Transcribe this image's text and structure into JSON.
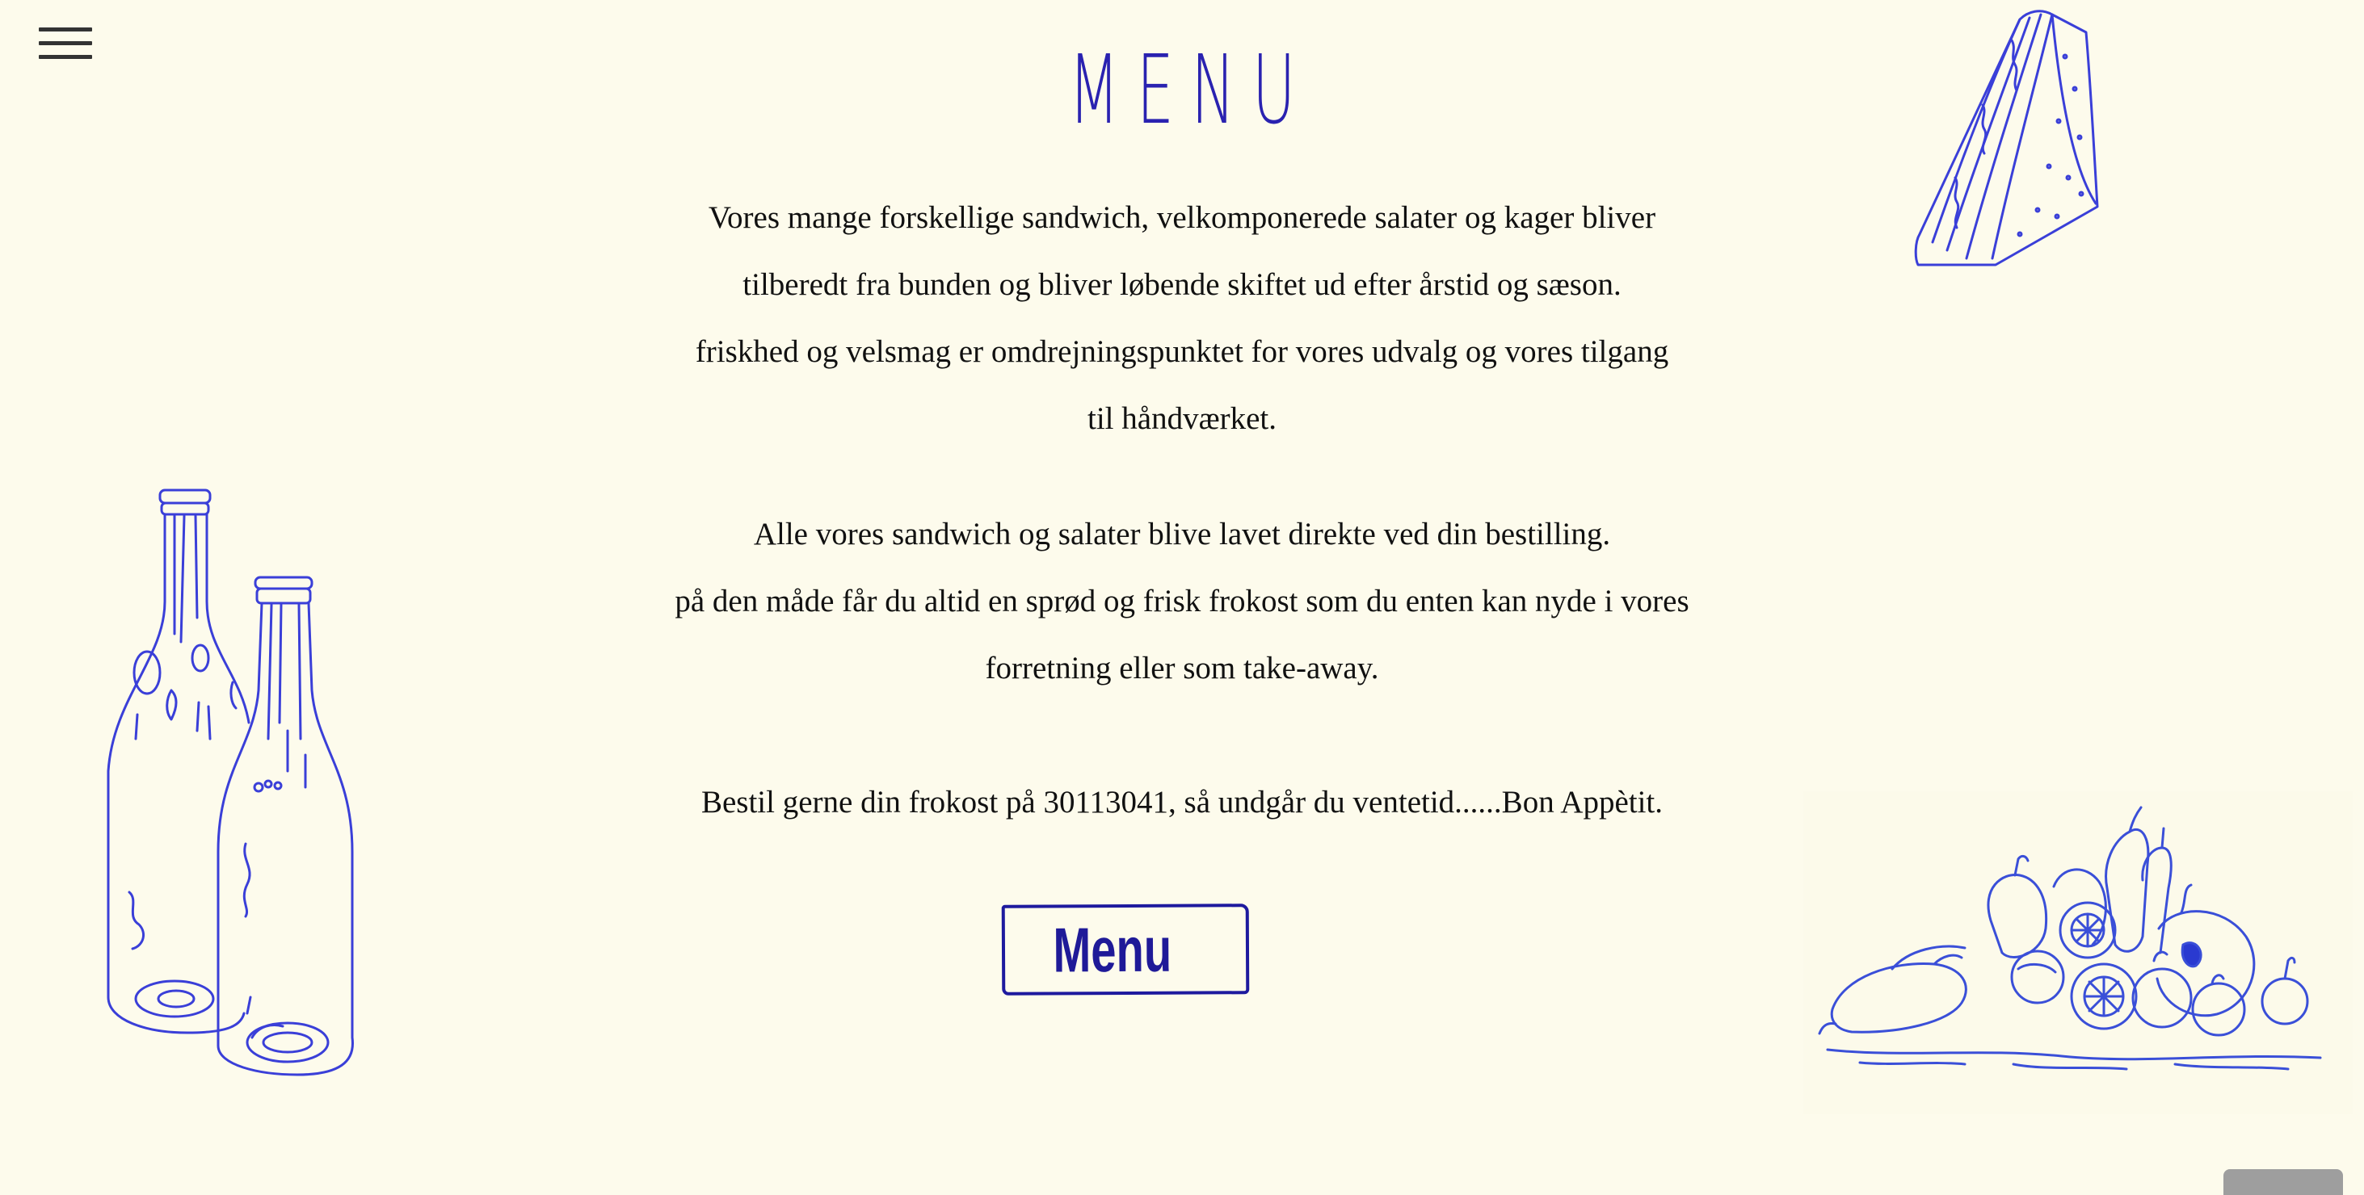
{
  "header": {
    "title": "MENU"
  },
  "intro": {
    "paragraph1": [
      "Vores mange forskellige sandwich, velkomponerede salater og kager bliver",
      "tilberedt fra bunden og bliver løbende skiftet ud efter årstid og sæson.",
      "friskhed og velsmag er omdrejningspunktet for vores udvalg og vores tilgang",
      "til håndværket."
    ],
    "paragraph2": [
      "Alle vores sandwich og salater blive lavet direkte ved din bestilling.",
      "på den måde får du altid en sprød og frisk frokost som du enten kan nyde i vores",
      "forretning eller som take-away."
    ],
    "paragraph3": [
      "Bestil gerne din frokost på 30113041, så undgår du ventetid......Bon Appètit."
    ]
  },
  "menu_button": {
    "label": "Menu"
  },
  "icons": {
    "nav": "hamburger-menu-icon",
    "illustrations": [
      "bottles-illustration",
      "sandwich-illustration",
      "vegetables-illustration"
    ]
  },
  "colors": {
    "background": "#fdfbec",
    "accent": "#2a22b0",
    "text": "#111111",
    "illustration": "#3a3fd8"
  }
}
